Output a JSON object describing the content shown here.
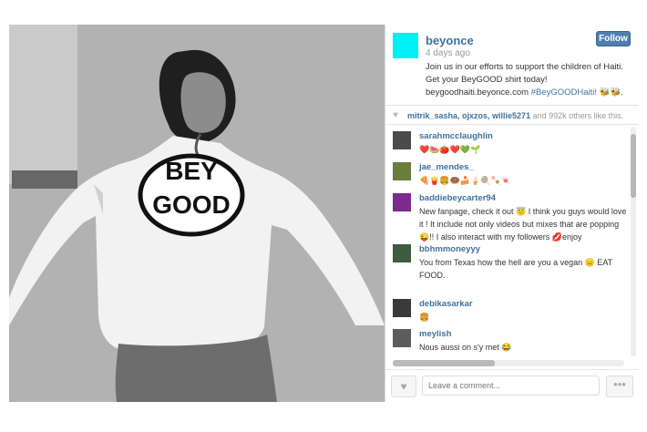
{
  "post": {
    "username": "beyonce",
    "time": "4 days ago",
    "follow_label": "Follow",
    "caption_line1": "Join us in our efforts to support the children of Haiti.",
    "caption_line2": "Get your BeyGOOD shirt today!",
    "caption_url": "beygoodhaiti.beyonce.com",
    "caption_hashtag": "#BeyGOODHaiti!",
    "caption_emoji": "🐝🐝.",
    "shirt_line1": "BEY",
    "shirt_line2": "GOOD"
  },
  "likes": {
    "users": "mitrik_sasha, ojxzos, willie5271",
    "count_text": "and 992k others like this."
  },
  "comments": [
    {
      "user": "sarahmcclaughlin",
      "text": "❤️🍉🍅❤️💚🌱"
    },
    {
      "user": "jae_mendes_",
      "text": "🍕🍟🍔🍩🍰🍦🍭🍡🍬"
    },
    {
      "user": "baddiebeycarter94",
      "text": "New fanpage, check it out 😇 I think you guys would love it ! It include not only videos but mixes that are popping 😜!! I also interact with my followers 💋enjoy"
    },
    {
      "user": "bbhmmoneyyy",
      "text": "You from Texas how the hell are you a vegan 😑 EAT FOOD."
    },
    {
      "user": "debikasarkar",
      "text": "🍔"
    },
    {
      "user": "meylish",
      "text": "Nous aussi on s'y met 😂"
    }
  ],
  "comment_box": {
    "placeholder": "Leave a comment..."
  },
  "icons": {
    "heart": "heart-icon",
    "more": "more-icon"
  },
  "colors": {
    "link": "#3f729b",
    "follow": "#4f7faf",
    "avatar": "#00f0f5"
  }
}
